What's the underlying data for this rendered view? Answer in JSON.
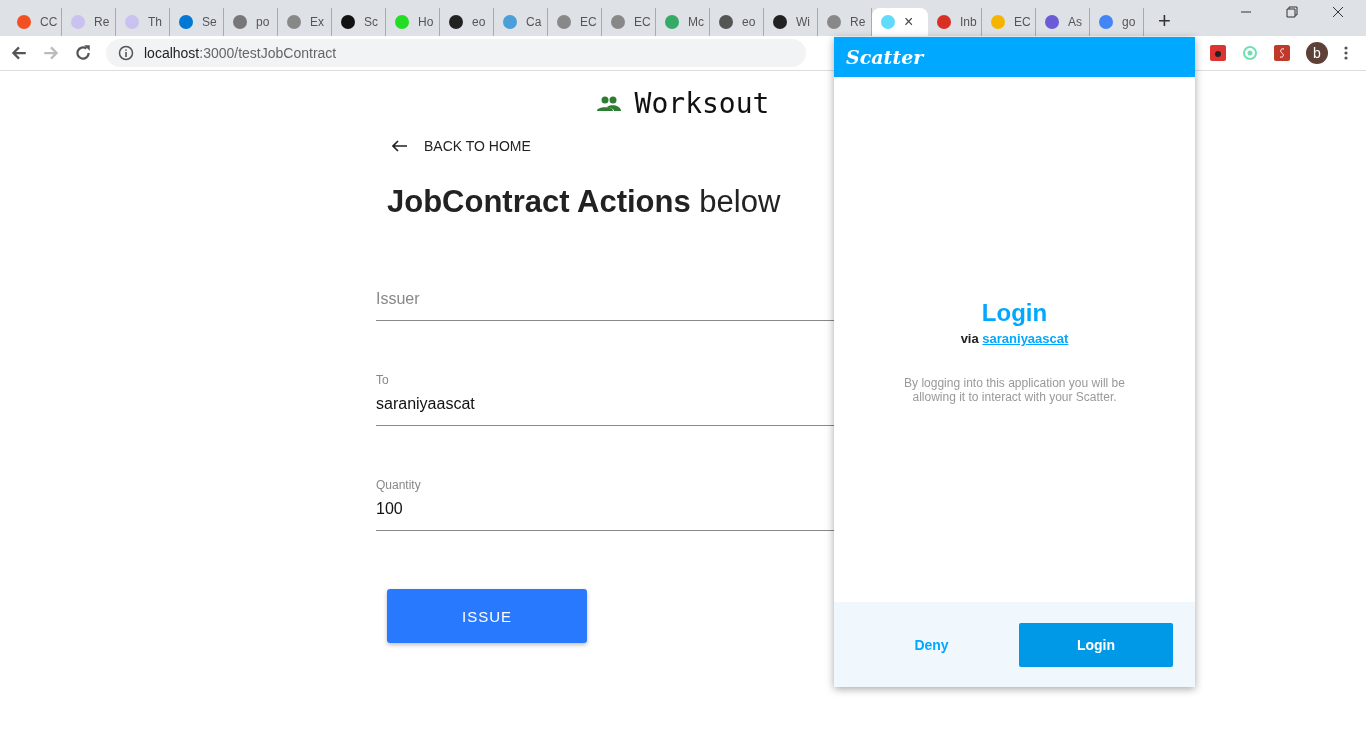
{
  "browser": {
    "tabs": [
      {
        "label": "CC",
        "selected": false
      },
      {
        "label": "Re",
        "selected": false
      },
      {
        "label": "Th",
        "selected": false
      },
      {
        "label": "Se",
        "selected": false
      },
      {
        "label": "po",
        "selected": false
      },
      {
        "label": "Ex",
        "selected": false
      },
      {
        "label": "Sc",
        "selected": false
      },
      {
        "label": "Ho",
        "selected": false
      },
      {
        "label": "eo",
        "selected": false
      },
      {
        "label": "Ca",
        "selected": false
      },
      {
        "label": "EC",
        "selected": false
      },
      {
        "label": "EC",
        "selected": false
      },
      {
        "label": "Mc",
        "selected": false
      },
      {
        "label": "eo",
        "selected": false
      },
      {
        "label": "Wi",
        "selected": false
      },
      {
        "label": "Re",
        "selected": false
      },
      {
        "selected": true,
        "close": "×"
      },
      {
        "label": "Inb",
        "selected": false
      },
      {
        "label": "EC",
        "selected": false
      },
      {
        "label": "As",
        "selected": false
      },
      {
        "label": "go",
        "selected": false
      }
    ],
    "new_tab": "+",
    "address": {
      "host": "localhost",
      "path": ":3000/testJobContract"
    },
    "avatar": "b"
  },
  "page": {
    "brand": "Worksout",
    "back_link": "BACK TO HOME",
    "heading": {
      "bold": "JobContract Actions",
      "rest": "below"
    },
    "fields": [
      {
        "placeholder": "Issuer"
      },
      {
        "label": "To",
        "value": "saraniyaascat"
      },
      {
        "label": "Quantity",
        "value": "100"
      }
    ],
    "submit": "ISSUE"
  },
  "popup": {
    "brand": "Scatter",
    "title": "Login",
    "via": "via",
    "account": "saraniyaascat",
    "message": "By logging into this application you will be allowing it to interact with your Scatter.",
    "buttons": [
      {
        "label": "Deny",
        "kind": "secondary"
      },
      {
        "label": "Login",
        "kind": "primary"
      }
    ]
  }
}
